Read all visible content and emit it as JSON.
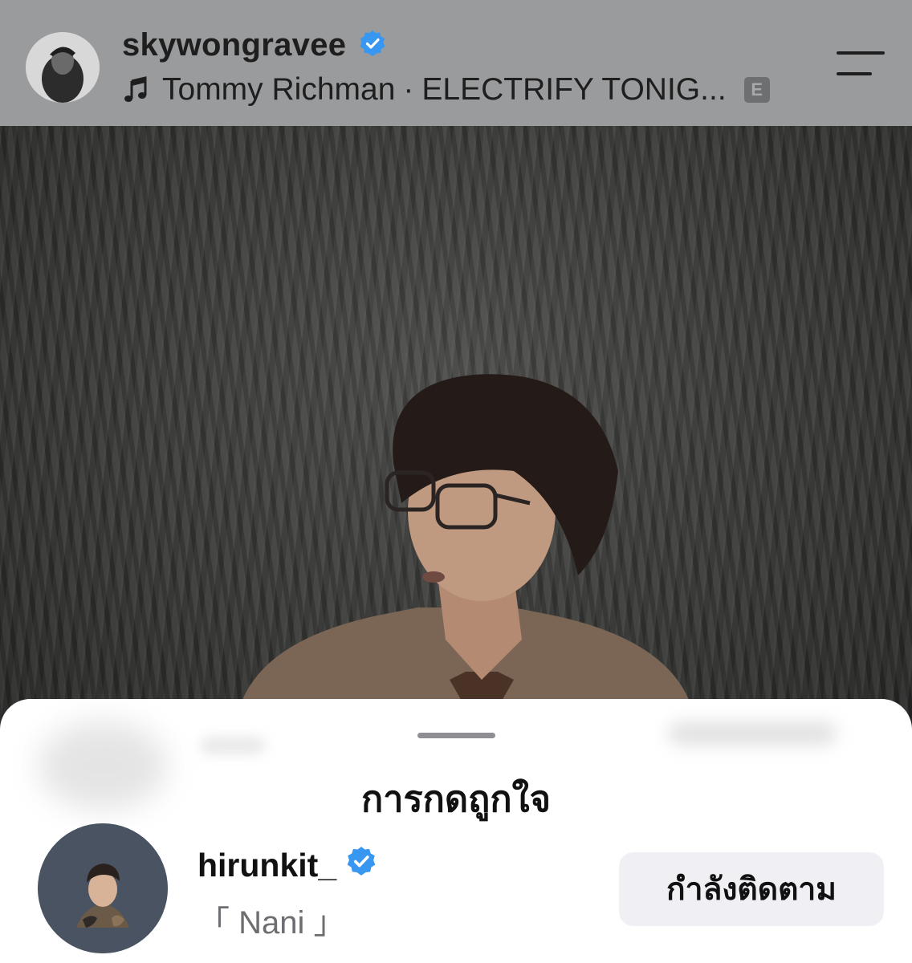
{
  "header": {
    "username": "skywongravee",
    "verified": true,
    "music_artist": "Tommy Richman",
    "music_separator": "·",
    "music_title": "ELECTRIFY TONIG...",
    "explicit_badge": "E"
  },
  "icons": {
    "avatar": "profile-avatar",
    "verified": "verified-badge-icon",
    "music": "music-note-icon",
    "menu": "menu-icon"
  },
  "sheet": {
    "title": "การกดถูกใจ",
    "items": [
      {
        "username": "hirunkit_",
        "verified": true,
        "display_name": "「 Nani 」",
        "button_label": "กำลังติดตาม"
      }
    ]
  },
  "colors": {
    "verified_blue": "#3897f0",
    "topbar_bg": "#9a9b9c",
    "button_bg": "#efeff4"
  }
}
